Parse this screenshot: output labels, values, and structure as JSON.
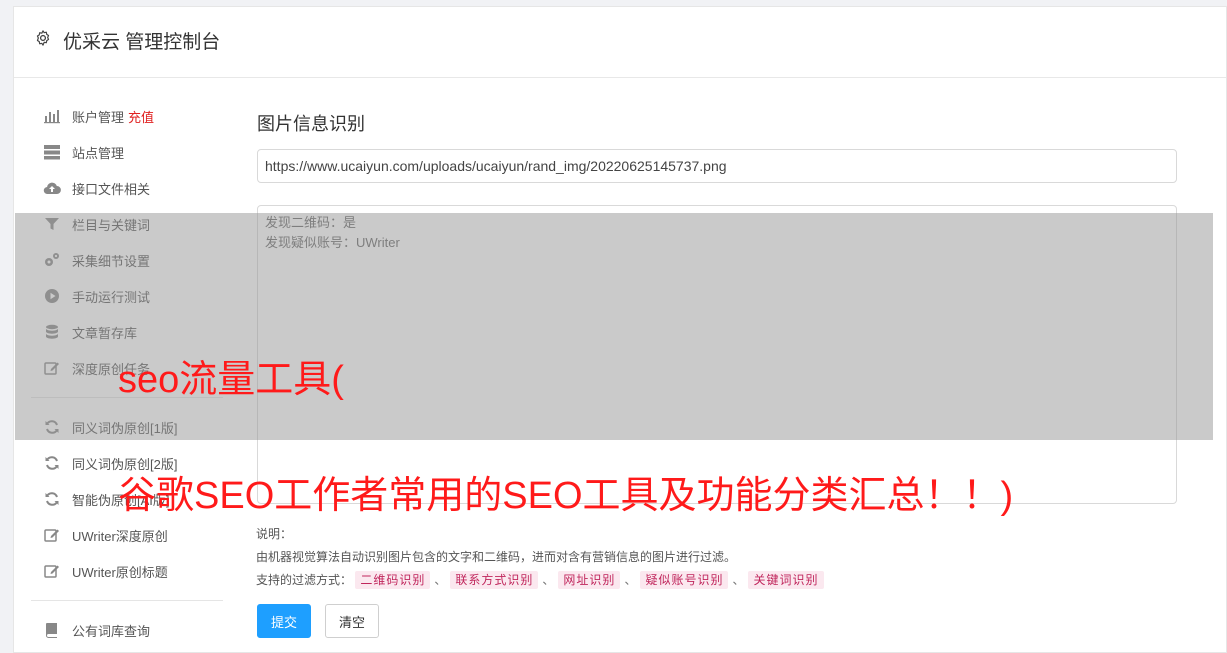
{
  "header": {
    "title": "优采云 管理控制台",
    "icon": "gear-icon"
  },
  "sidebar": {
    "items": [
      {
        "label": "账户管理",
        "badge": "充值",
        "icon": "bar-chart-icon"
      },
      {
        "label": "站点管理",
        "icon": "server-icon"
      },
      {
        "label": "接口文件相关",
        "icon": "cloud-upload-icon"
      },
      {
        "label": "栏目与关键词",
        "icon": "filter-icon"
      },
      {
        "label": "采集细节设置",
        "icon": "cogs-icon"
      },
      {
        "label": "手动运行测试",
        "icon": "play-circle-icon"
      },
      {
        "label": "文章暂存库",
        "icon": "database-icon"
      },
      {
        "label": "深度原创任务",
        "icon": "edit-icon"
      },
      {
        "label": "同义词伪原创[1版]",
        "icon": "refresh-icon"
      },
      {
        "label": "同义词伪原创[2版]",
        "icon": "refresh-icon"
      },
      {
        "label": "智能伪原创[AI版]",
        "icon": "refresh-icon"
      },
      {
        "label": "UWriter深度原创",
        "icon": "edit-icon"
      },
      {
        "label": "UWriter原创标题",
        "icon": "edit-icon"
      },
      {
        "label": "公有词库查询",
        "icon": "book-icon"
      }
    ]
  },
  "main": {
    "heading": "图片信息识别",
    "url_value": "https://www.ucaiyun.com/uploads/ucaiyun/rand_img/20220625145737.png",
    "result_lines": [
      "发现二维码：是",
      "发现疑似账号：UWriter"
    ],
    "notes_title": "说明：",
    "notes_desc": "由机器视觉算法自动识别图片包含的文字和二维码，进而对含有营销信息的图片进行过滤。",
    "filter_label": "支持的过滤方式：",
    "filter_tags": [
      "二维码识别",
      "联系方式识别",
      "网址识别",
      "疑似账号识别",
      "关键词识别"
    ],
    "tag_separator": "、",
    "submit_label": "提交",
    "clear_label": "清空"
  },
  "overlay": {
    "line1": "seo流量工具(",
    "line2": "谷歌SEO工作者常用的SEO工具及功能分类汇总！！)",
    "text_color": "#ff1a1a"
  },
  "colors": {
    "primary": "#1e9fff",
    "badge": "#e02020",
    "tag_bg": "#fbe8ef",
    "tag_text": "#c0265c"
  }
}
